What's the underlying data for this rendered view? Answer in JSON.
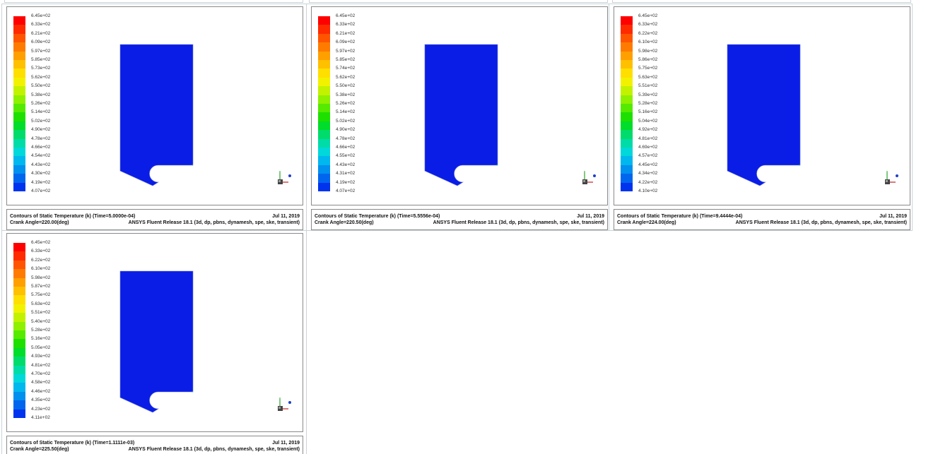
{
  "background_color": "#ffffff",
  "contour_fill_color": "#0a1de6",
  "panels": [
    {
      "caption_title": "Contours of Static Temperature (k)  (Time=5.0000e-04)",
      "caption_date": "Jul 11, 2019",
      "crank_angle": "Crank Angle=220.00(deg)",
      "release": "ANSYS Fluent Release 18.1 (3d, dp, pbns, dynamesh, spe, ske, transient)",
      "labels": [
        "6.45e+02",
        "6.33e+02",
        "6.21e+02",
        "6.09e+02",
        "5.97e+02",
        "5.85e+02",
        "5.73e+02",
        "5.62e+02",
        "5.50e+02",
        "5.38e+02",
        "5.26e+02",
        "5.14e+02",
        "5.02e+02",
        "4.90e+02",
        "4.78e+02",
        "4.66e+02",
        "4.54e+02",
        "4.43e+02",
        "4.30e+02",
        "4.19e+02",
        "4.07e+02"
      ]
    },
    {
      "caption_title": "Contours of Static Temperature (k)  (Time=5.5556e-04)",
      "caption_date": "Jul 11, 2019",
      "crank_angle": "Crank Angle=220.50(deg)",
      "release": "ANSYS Fluent Release 18.1 (3d, dp, pbns, dynamesh, spe, ske, transient)",
      "labels": [
        "6.45e+02",
        "6.33e+02",
        "6.21e+02",
        "6.09e+02",
        "5.97e+02",
        "5.85e+02",
        "5.74e+02",
        "5.62e+02",
        "5.50e+02",
        "5.38e+02",
        "5.26e+02",
        "5.14e+02",
        "5.02e+02",
        "4.90e+02",
        "4.78e+02",
        "4.66e+02",
        "4.55e+02",
        "4.43e+02",
        "4.31e+02",
        "4.19e+02",
        "4.07e+02"
      ]
    },
    {
      "caption_title": "Contours of Static Temperature (k)  (Time=9.4444e-04)",
      "caption_date": "Jul 11, 2019",
      "crank_angle": "Crank Angle=224.00(deg)",
      "release": "ANSYS Fluent Release 18.1 (3d, dp, pbns, dynamesh, spe, ske, transient)",
      "labels": [
        "6.45e+02",
        "6.33e+02",
        "6.22e+02",
        "6.10e+02",
        "5.98e+02",
        "5.86e+02",
        "5.75e+02",
        "5.63e+02",
        "5.51e+02",
        "5.39e+02",
        "5.28e+02",
        "5.16e+02",
        "5.04e+02",
        "4.92e+02",
        "4.81e+02",
        "4.69e+02",
        "4.57e+02",
        "4.45e+02",
        "4.34e+02",
        "4.22e+02",
        "4.10e+02"
      ]
    },
    {
      "caption_title": "Contours of Static Temperature (k)  (Time=1.1111e-03)",
      "caption_date": "Jul 11, 2019",
      "crank_angle": "Crank Angle=225.50(deg)",
      "release": "ANSYS Fluent Release 18.1 (3d, dp, pbns, dynamesh, spe, ske, transient)",
      "labels": [
        "6.45e+02",
        "6.33e+02",
        "6.22e+02",
        "6.10e+02",
        "5.98e+02",
        "5.87e+02",
        "5.75e+02",
        "5.63e+02",
        "5.51e+02",
        "5.40e+02",
        "5.28e+02",
        "5.16e+02",
        "5.05e+02",
        "4.93e+02",
        "4.81e+02",
        "4.70e+02",
        "4.58e+02",
        "4.46e+02",
        "4.35e+02",
        "4.23e+02",
        "4.11e+02"
      ]
    }
  ],
  "colormap": [
    "#ff0000",
    "#ff2a00",
    "#ff5500",
    "#ff7b00",
    "#ff9f00",
    "#ffc000",
    "#ffdf00",
    "#f2f200",
    "#c3f200",
    "#8ff000",
    "#55ea00",
    "#1ee000",
    "#00dd2a",
    "#00dc6c",
    "#00dca8",
    "#00d8da",
    "#00b7ee",
    "#0090ee",
    "#0066ee",
    "#0033ee"
  ]
}
